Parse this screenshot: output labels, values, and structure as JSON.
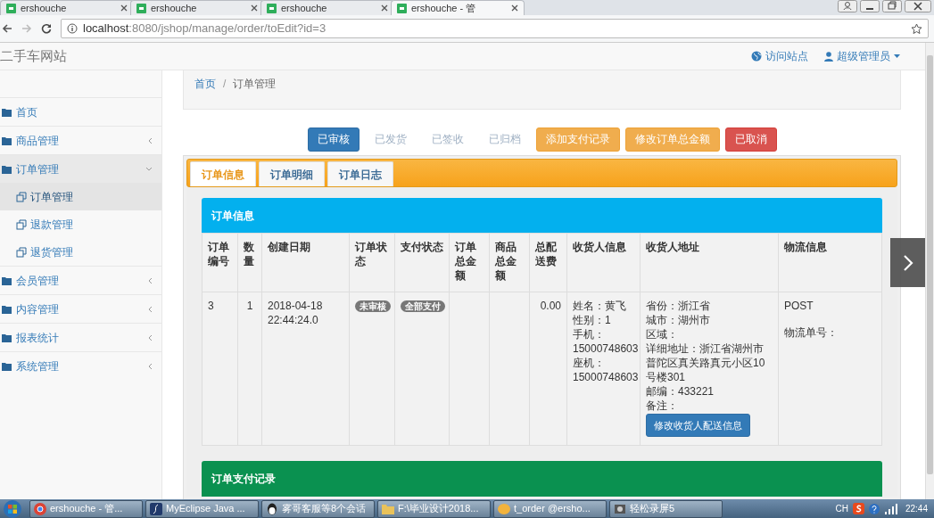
{
  "browser": {
    "tabs": [
      {
        "label": "ershouche",
        "selected": false
      },
      {
        "label": "ershouche",
        "selected": false
      },
      {
        "label": "ershouche",
        "selected": false
      },
      {
        "label": "ershouche - 管",
        "selected": true
      }
    ],
    "url_host": "localhost",
    "url_path": ":8080/jshop/manage/order/toEdit?id=3"
  },
  "navbar": {
    "brand": "二手车网站",
    "visit_link": "访问站点",
    "user_menu": "超级管理员"
  },
  "sidebar": {
    "items": [
      {
        "label": "首页",
        "expandable": false,
        "expanded": false
      },
      {
        "label": "商品管理",
        "expandable": true,
        "expanded": false
      },
      {
        "label": "订单管理",
        "expandable": true,
        "expanded": true,
        "children": [
          {
            "label": "订单管理",
            "selected": true
          },
          {
            "label": "退款管理",
            "selected": false
          },
          {
            "label": "退货管理",
            "selected": false
          }
        ]
      },
      {
        "label": "会员管理",
        "expandable": true,
        "expanded": false
      },
      {
        "label": "内容管理",
        "expandable": true,
        "expanded": false
      },
      {
        "label": "报表统计",
        "expandable": true,
        "expanded": false
      },
      {
        "label": "系统管理",
        "expandable": true,
        "expanded": false
      }
    ]
  },
  "breadcrumb": {
    "separator": "/",
    "items": [
      "首页",
      "订单管理"
    ]
  },
  "actions": [
    {
      "label": "已审核",
      "kind": "primary"
    },
    {
      "label": "已发货",
      "kind": "disabled"
    },
    {
      "label": "已签收",
      "kind": "disabled"
    },
    {
      "label": "已归档",
      "kind": "disabled"
    },
    {
      "label": "添加支付记录",
      "kind": "warning"
    },
    {
      "label": "修改订单总金额",
      "kind": "warning"
    },
    {
      "label": "已取消",
      "kind": "danger"
    }
  ],
  "tabs": [
    {
      "label": "订单信息",
      "selected": true
    },
    {
      "label": "订单明细",
      "selected": false
    },
    {
      "label": "订单日志",
      "selected": false
    }
  ],
  "order_panel": {
    "title": "订单信息",
    "columns": [
      "订单编号",
      "数量",
      "创建日期",
      "订单状态",
      "支付状态",
      "订单总金额",
      "商品总金额",
      "总配送费",
      "收货人信息",
      "收货人地址",
      "物流信息"
    ],
    "row": {
      "order_no": "3",
      "quantity": "1",
      "created": "2018-04-18 22:44:24.0",
      "order_status": "未审核",
      "pay_status": "全部支付",
      "shipping": "0.00",
      "receiver": [
        "姓名：黄飞",
        "性别：1",
        "手机：15000748603",
        "座机：15000748603"
      ],
      "address": [
        "省份：浙江省",
        "城市：湖州市",
        "区域：",
        "详细地址：浙江省湖州市普陀区真关路真元小区10号楼301",
        "邮编：433221",
        "备注："
      ],
      "address_button": "修改收货人配送信息",
      "logistics": [
        "POST",
        "物流单号："
      ]
    }
  },
  "payment_panel": {
    "title": "订单支付记录"
  },
  "taskbar": {
    "items": [
      {
        "label": "ershouche - 管..."
      },
      {
        "label": "MyEclipse Java ..."
      },
      {
        "label": "雾哥客服等8个会话"
      },
      {
        "label": "F:\\毕业设计2018..."
      },
      {
        "label": "t_order @ersho..."
      },
      {
        "label": "轻松录屏5"
      }
    ],
    "language": "CH",
    "time": "22:44"
  }
}
